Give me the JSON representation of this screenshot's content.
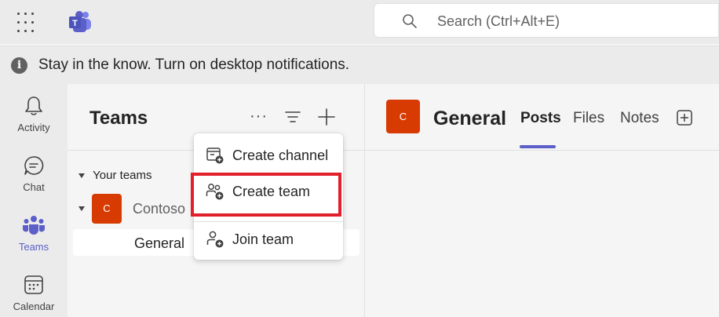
{
  "search": {
    "placeholder": "Search (Ctrl+Alt+E)"
  },
  "notification": {
    "text": "Stay in the know. Turn on desktop notifications.",
    "icon": "info-icon"
  },
  "rail": {
    "items": [
      {
        "label": "Activity",
        "icon": "bell-icon"
      },
      {
        "label": "Chat",
        "icon": "chat-icon"
      },
      {
        "label": "Teams",
        "icon": "teams-icon",
        "active": true
      },
      {
        "label": "Calendar",
        "icon": "calendar-icon"
      }
    ]
  },
  "teams_pane": {
    "title": "Teams",
    "more": "···",
    "section": "Your teams",
    "team": {
      "name": "Contoso",
      "avatar": "C"
    },
    "channel": "General"
  },
  "menu": {
    "items": [
      {
        "label": "Create channel",
        "icon": "channel-add-icon"
      },
      {
        "label": "Create team",
        "icon": "people-add-icon",
        "highlighted": true
      },
      {
        "label": "Join team",
        "icon": "person-add-icon"
      }
    ]
  },
  "channel": {
    "avatar": "C",
    "title": "General",
    "tabs": [
      "Posts",
      "Files",
      "Notes"
    ],
    "active_tab": "Posts"
  },
  "colors": {
    "accent": "#5b5fc7",
    "team_avatar": "#d83b01",
    "highlight": "#e2202b"
  }
}
